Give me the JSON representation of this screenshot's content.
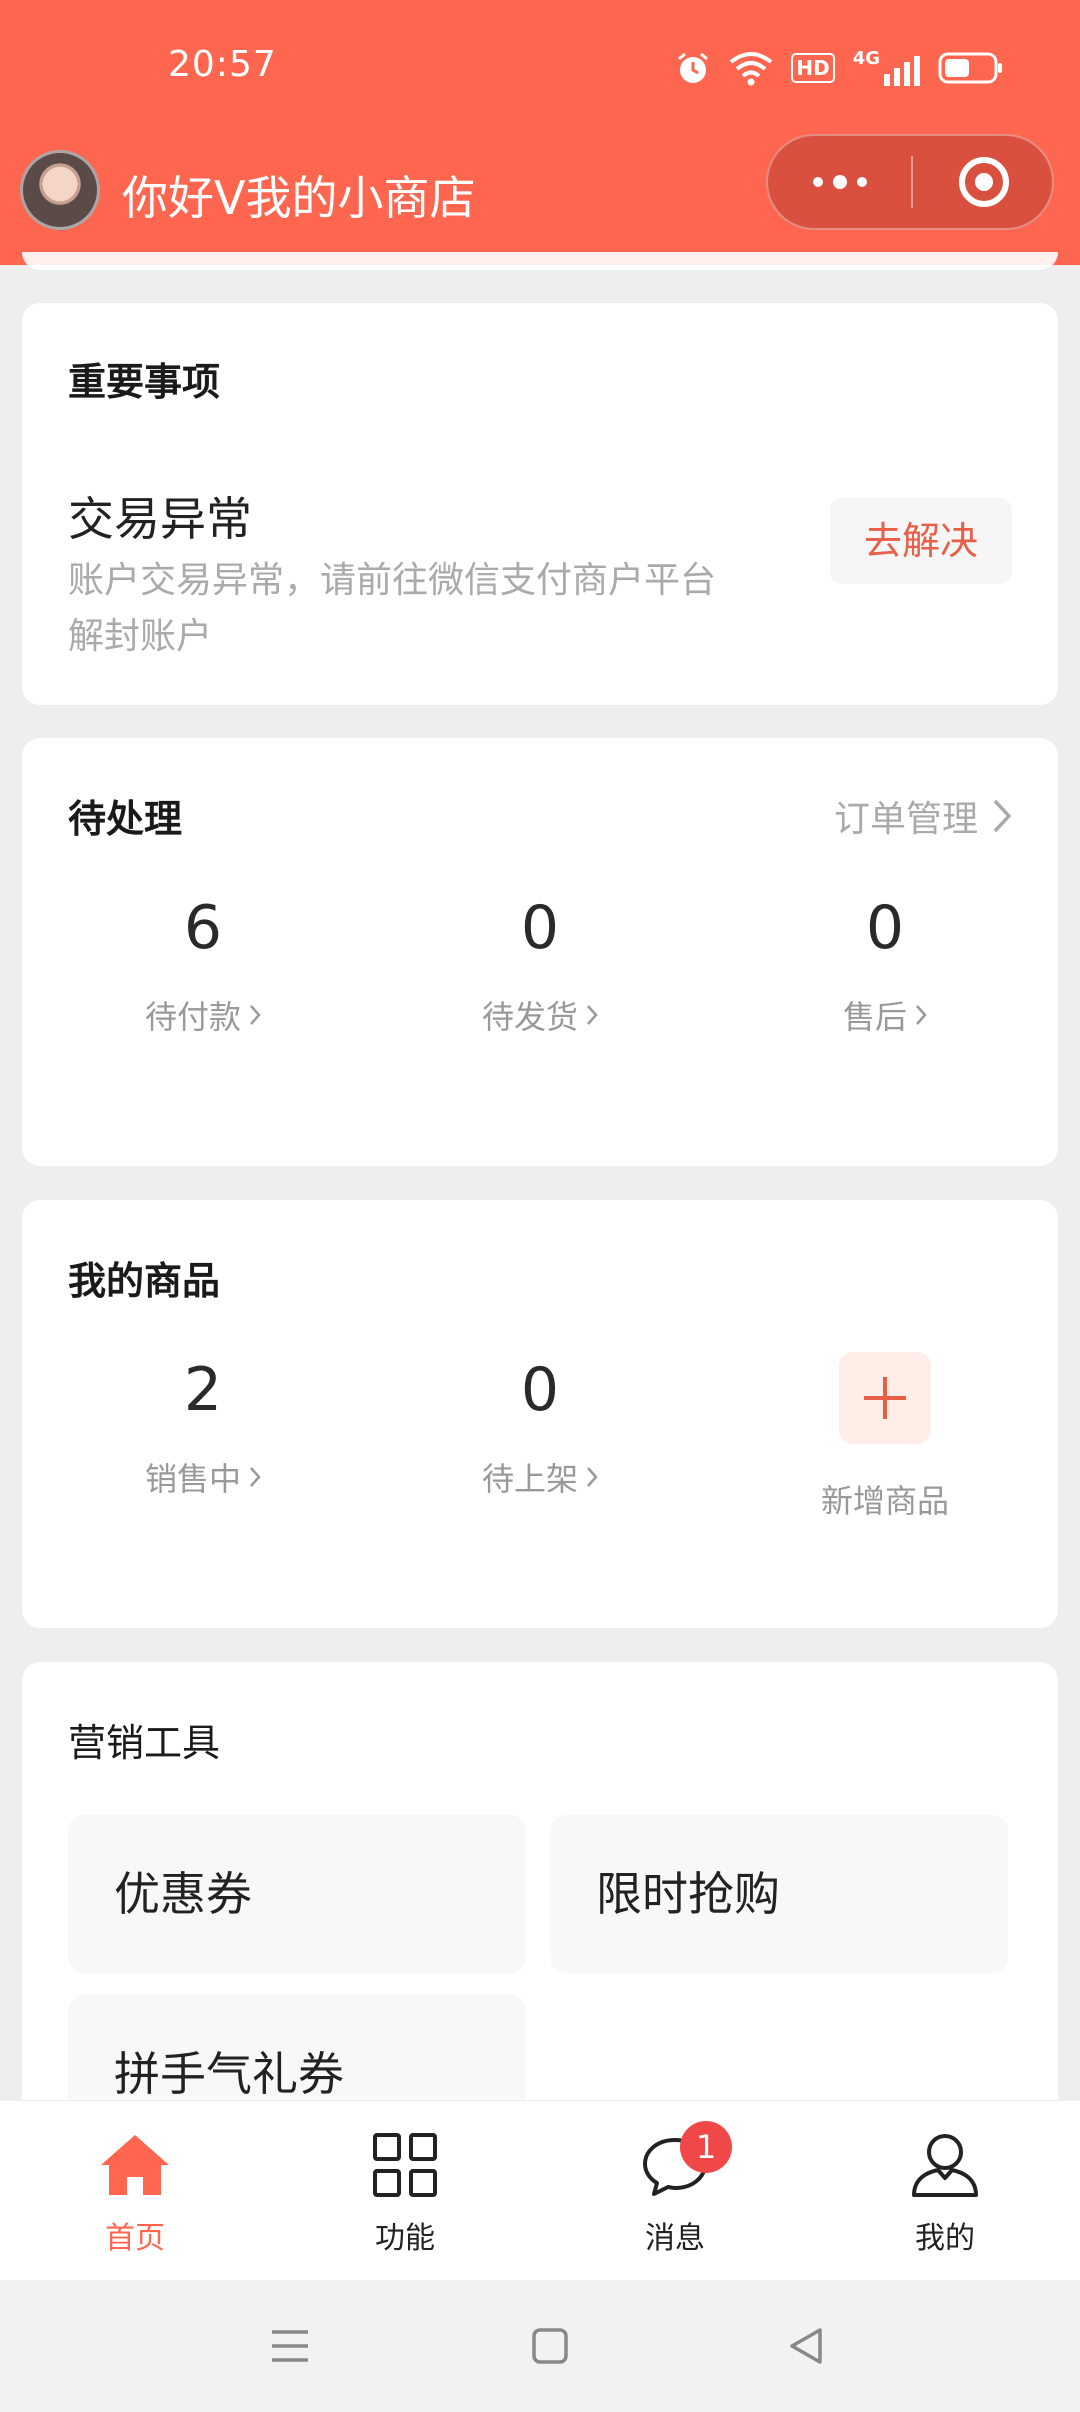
{
  "status_bar": {
    "time": "20:57",
    "icons": [
      "alarm-icon",
      "wifi-icon",
      "hd-icon",
      "4g-signal-icon",
      "battery-icon"
    ],
    "hd_label": "HD",
    "network_label": "4G"
  },
  "header": {
    "title": "你好V我的小商店",
    "background_color": "#FF6650",
    "capsule": {
      "more_icon": "more-dots-icon",
      "close_icon": "target-close-icon"
    }
  },
  "important": {
    "title": "重要事项",
    "issue_title": "交易异常",
    "issue_desc": "账户交易异常，请前往微信支付商户平台解封账户",
    "action_label": "去解决"
  },
  "pending": {
    "title": "待处理",
    "link_label": "订单管理",
    "stats": [
      {
        "value": "6",
        "label": "待付款"
      },
      {
        "value": "0",
        "label": "待发货"
      },
      {
        "value": "0",
        "label": "售后"
      }
    ]
  },
  "products": {
    "title": "我的商品",
    "stats": [
      {
        "value": "2",
        "label": "销售中"
      },
      {
        "value": "0",
        "label": "待上架"
      }
    ],
    "add_label": "新增商品"
  },
  "marketing": {
    "title": "营销工具",
    "tools": [
      "优惠券",
      "限时抢购",
      "拼手气礼券"
    ]
  },
  "tabbar": {
    "tabs": [
      {
        "label": "首页",
        "icon": "home-icon",
        "active": true
      },
      {
        "label": "功能",
        "icon": "grid-icon",
        "active": false
      },
      {
        "label": "消息",
        "icon": "chat-icon",
        "active": false,
        "badge": "1"
      },
      {
        "label": "我的",
        "icon": "user-icon",
        "active": false
      }
    ],
    "accent_color": "#FF6650"
  },
  "system_nav": {
    "icons": [
      "menu-icon",
      "home-square-icon",
      "back-triangle-icon"
    ]
  }
}
